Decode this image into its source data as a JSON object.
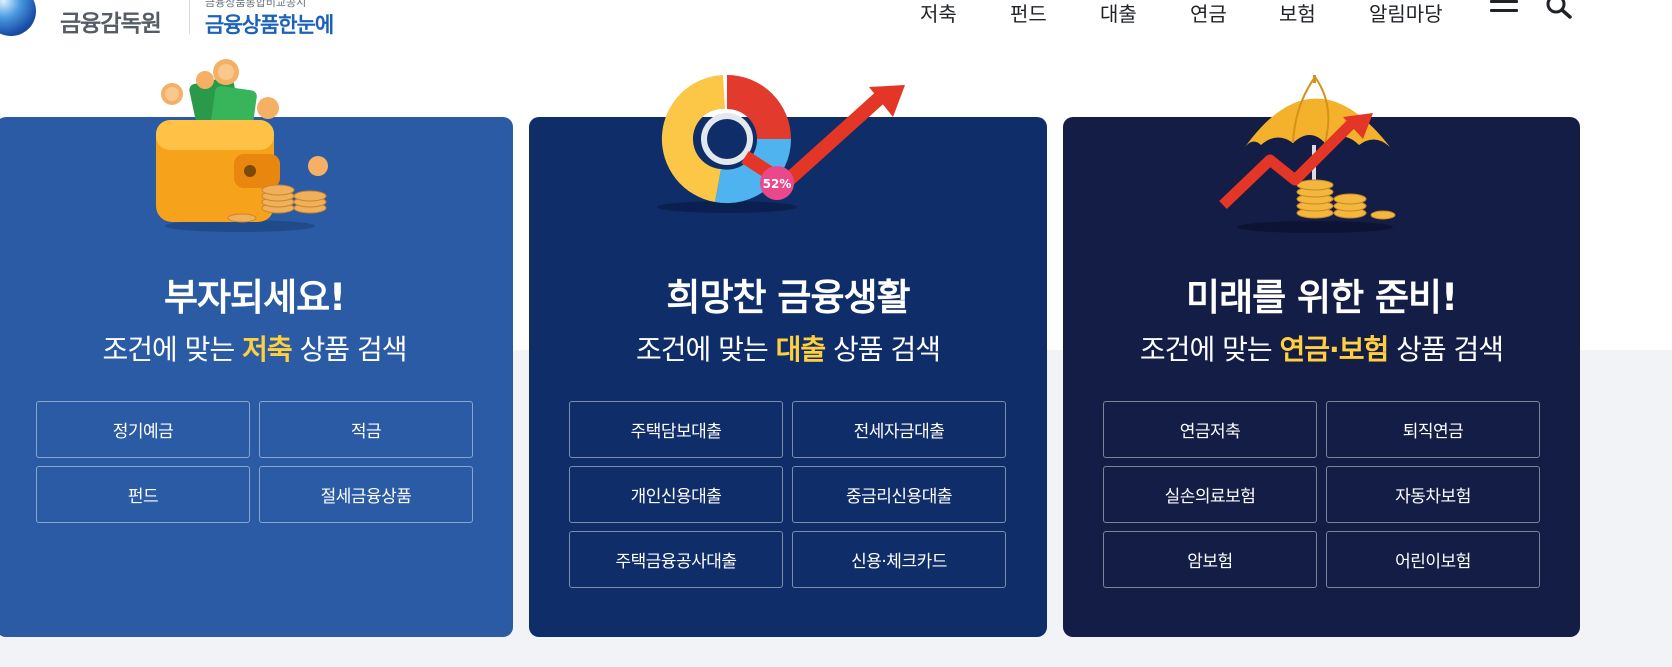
{
  "header": {
    "logo_text": "금융감독원",
    "logo_sub": "금융상품통합비교공시",
    "service_name": "금융상품한눈에",
    "nav": [
      "저축",
      "펀드",
      "대출",
      "연금",
      "보험",
      "알림마당"
    ]
  },
  "cards": [
    {
      "title": "부자되세요!",
      "sub_prefix": "조건에 맞는 ",
      "sub_highlight": "저축",
      "sub_suffix": " 상품 검색",
      "buttons": [
        "정기예금",
        "적금",
        "펀드",
        "절세금융상품"
      ],
      "color": "#2a5ba4"
    },
    {
      "title": "희망찬 금융생활",
      "sub_prefix": "조건에 맞는 ",
      "sub_highlight": "대출",
      "sub_suffix": " 상품 검색",
      "buttons": [
        "주택담보대출",
        "전세자금대출",
        "개인신용대출",
        "중금리신용대출",
        "주택금융공사대출",
        "신용·체크카드"
      ],
      "badge": "52%",
      "color": "#0f2e69"
    },
    {
      "title": "미래를 위한 준비!",
      "sub_prefix": "조건에 맞는 ",
      "sub_highlight": "연금·보험",
      "sub_suffix": " 상품 검색",
      "buttons": [
        "연금저축",
        "퇴직연금",
        "실손의료보험",
        "자동차보험",
        "암보험",
        "어린이보험"
      ],
      "color": "#141d45"
    }
  ],
  "icons": [
    "globe-logo-icon",
    "menu-icon",
    "search-icon",
    "wallet-illustration",
    "chart-arrow-illustration",
    "umbrella-illustration"
  ],
  "highlight_color": "#ffcf3e"
}
